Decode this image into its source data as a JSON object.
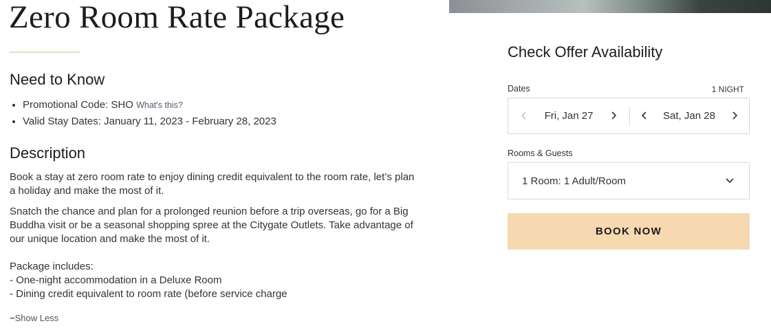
{
  "page": {
    "title": "Zero Room Rate Package"
  },
  "need_to_know": {
    "heading": "Need to Know",
    "promo_label": "Promotional Code: SHO",
    "promo_help_link": "What's this?",
    "valid_dates": "Valid Stay Dates: January 11, 2023 - February 28, 2023"
  },
  "description": {
    "heading": "Description",
    "paragraph_1": "Book a stay at zero room rate to enjoy dining credit equivalent to the room rate, let’s plan a holiday and make the most of it.",
    "paragraph_2": "Snatch the chance and plan for a prolonged reunion before a trip overseas, go for a Big Buddha visit or be a seasonal shopping spree at the Citygate Outlets. Take advantage of our unique location and make the most of it.",
    "includes_heading": "Package includes:",
    "includes": [
      "- One-night accommodation in a Deluxe Room",
      "- Dining credit equivalent to room rate (before service charge"
    ],
    "toggle_label": "Show Less"
  },
  "booking_panel": {
    "heading": "Check Offer Availability",
    "dates_label": "Dates",
    "nights_label": "1 NIGHT",
    "check_in": "Fri, Jan 27",
    "check_out": "Sat, Jan 28",
    "rooms_label": "Rooms & Guests",
    "rooms_value": "1 Room: 1 Adult/Room",
    "book_button": "BOOK NOW"
  },
  "icons": {
    "prev": "chevron-left-icon",
    "next": "chevron-right-icon",
    "dropdown": "chevron-down-icon",
    "collapse": "minus-icon"
  },
  "colors": {
    "accent_button": "#f6d8b1",
    "title_rule": "#e7dcc5",
    "text": "#222222",
    "border": "#d9d9d9",
    "disabled_arrow": "#c4c4c4"
  }
}
